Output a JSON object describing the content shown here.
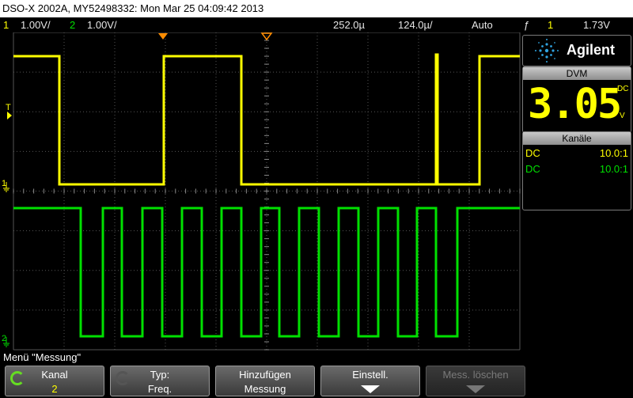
{
  "titlebar": {
    "text": "DSO-X 2002A, MY52498332: Mon Mar 25 04:09:42 2013"
  },
  "statusbar": {
    "ch1_num": "1",
    "ch1_scale": "1.00V/",
    "ch2_num": "2",
    "ch2_scale": "1.00V/",
    "timebase_pos": "252.0µ",
    "timebase_scale": "124.0µ/",
    "trigger_mode": "Auto",
    "trigger_slope_glyph": "ƒ",
    "trigger_source": "1",
    "trigger_level": "1.73V"
  },
  "colors": {
    "ch1": "#ffff00",
    "ch2": "#00e000",
    "grid": "#555555",
    "trigger": "#ff8c00"
  },
  "screen_markers": {
    "trigger_T": "T",
    "ch1_marker": "1",
    "ch2_marker": "2"
  },
  "side_panel": {
    "logo": "Agilent",
    "dvm": {
      "header": "DVM",
      "value": "3.05",
      "mode": "DC",
      "unit": "V"
    },
    "kanaele": {
      "header": "Kanäle",
      "rows": [
        {
          "coupling": "DC",
          "probe": "10.0:1",
          "color": "#ffff00"
        },
        {
          "coupling": "DC",
          "probe": "10.0:1",
          "color": "#00e000"
        }
      ]
    }
  },
  "menu": {
    "title": "Menü \"Messung\""
  },
  "softkeys": [
    {
      "line1": "Kanal",
      "line2": "2",
      "icon": "rotate-knob-icon",
      "enabled": true
    },
    {
      "line1": "Typ:",
      "line2": "Freq.",
      "icon": "rotate-knob-icon",
      "enabled": true
    },
    {
      "line1": "Hinzufügen",
      "line2": "Messung",
      "enabled": true
    },
    {
      "line1": "Einstell.",
      "line2": "",
      "icon": "arrow-down-icon",
      "enabled": true
    },
    {
      "line1": "Mess. löschen",
      "line2": "",
      "icon": "arrow-down-icon",
      "enabled": false
    }
  ]
}
